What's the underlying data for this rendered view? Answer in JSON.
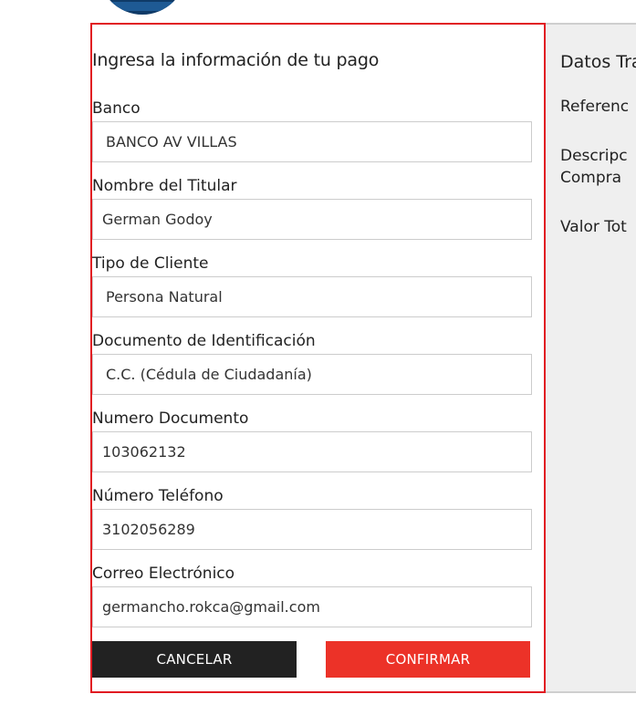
{
  "form": {
    "title": "Ingresa la información de tu pago",
    "fields": [
      {
        "label": "Banco",
        "value": "BANCO AV VILLAS"
      },
      {
        "label": "Nombre del Titular",
        "value": "German Godoy"
      },
      {
        "label": "Tipo de Cliente",
        "value": "Persona Natural"
      },
      {
        "label": "Documento de Identificación",
        "value": "C.C. (Cédula de Ciudadanía)"
      },
      {
        "label": "Numero Documento",
        "value": "103062132"
      },
      {
        "label": "Número Teléfono",
        "value": "3102056289"
      },
      {
        "label": "Correo Electrónico",
        "value": "germancho.rokca@gmail.com"
      }
    ],
    "cancel_label": "CANCELAR",
    "confirm_label": "CONFIRMAR"
  },
  "side": {
    "title": "Datos Tra",
    "reference_label": "Referenc",
    "description_label_1": "Descripc",
    "description_label_2": "Compra",
    "total_label": "Valor Tot"
  },
  "colors": {
    "border_accent": "#e11b22",
    "confirm_button": "#ec3228",
    "cancel_button": "#222222",
    "side_bg": "#efefef"
  }
}
